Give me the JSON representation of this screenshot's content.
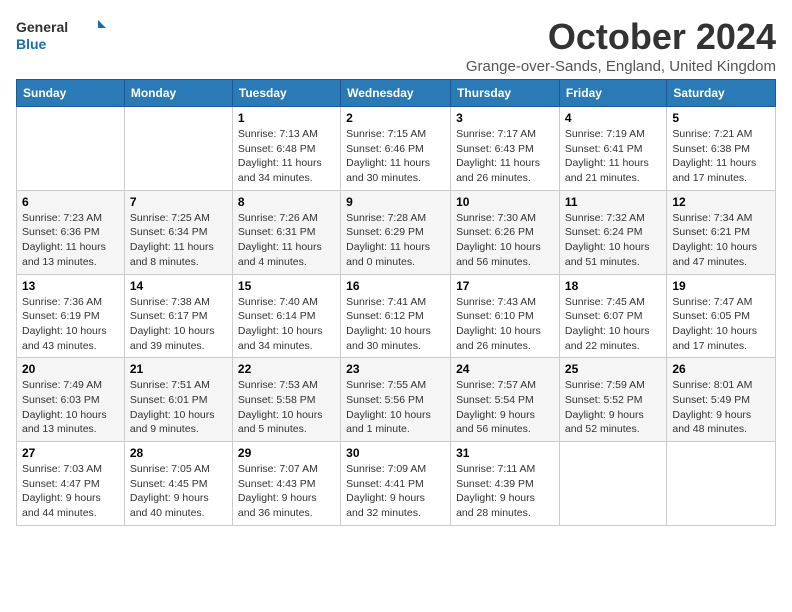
{
  "header": {
    "logo_line1": "General",
    "logo_line2": "Blue",
    "title": "October 2024",
    "location": "Grange-over-Sands, England, United Kingdom"
  },
  "columns": [
    "Sunday",
    "Monday",
    "Tuesday",
    "Wednesday",
    "Thursday",
    "Friday",
    "Saturday"
  ],
  "weeks": [
    [
      {
        "day": "",
        "info": ""
      },
      {
        "day": "",
        "info": ""
      },
      {
        "day": "1",
        "info": "Sunrise: 7:13 AM\nSunset: 6:48 PM\nDaylight: 11 hours and 34 minutes."
      },
      {
        "day": "2",
        "info": "Sunrise: 7:15 AM\nSunset: 6:46 PM\nDaylight: 11 hours and 30 minutes."
      },
      {
        "day": "3",
        "info": "Sunrise: 7:17 AM\nSunset: 6:43 PM\nDaylight: 11 hours and 26 minutes."
      },
      {
        "day": "4",
        "info": "Sunrise: 7:19 AM\nSunset: 6:41 PM\nDaylight: 11 hours and 21 minutes."
      },
      {
        "day": "5",
        "info": "Sunrise: 7:21 AM\nSunset: 6:38 PM\nDaylight: 11 hours and 17 minutes."
      }
    ],
    [
      {
        "day": "6",
        "info": "Sunrise: 7:23 AM\nSunset: 6:36 PM\nDaylight: 11 hours and 13 minutes."
      },
      {
        "day": "7",
        "info": "Sunrise: 7:25 AM\nSunset: 6:34 PM\nDaylight: 11 hours and 8 minutes."
      },
      {
        "day": "8",
        "info": "Sunrise: 7:26 AM\nSunset: 6:31 PM\nDaylight: 11 hours and 4 minutes."
      },
      {
        "day": "9",
        "info": "Sunrise: 7:28 AM\nSunset: 6:29 PM\nDaylight: 11 hours and 0 minutes."
      },
      {
        "day": "10",
        "info": "Sunrise: 7:30 AM\nSunset: 6:26 PM\nDaylight: 10 hours and 56 minutes."
      },
      {
        "day": "11",
        "info": "Sunrise: 7:32 AM\nSunset: 6:24 PM\nDaylight: 10 hours and 51 minutes."
      },
      {
        "day": "12",
        "info": "Sunrise: 7:34 AM\nSunset: 6:21 PM\nDaylight: 10 hours and 47 minutes."
      }
    ],
    [
      {
        "day": "13",
        "info": "Sunrise: 7:36 AM\nSunset: 6:19 PM\nDaylight: 10 hours and 43 minutes."
      },
      {
        "day": "14",
        "info": "Sunrise: 7:38 AM\nSunset: 6:17 PM\nDaylight: 10 hours and 39 minutes."
      },
      {
        "day": "15",
        "info": "Sunrise: 7:40 AM\nSunset: 6:14 PM\nDaylight: 10 hours and 34 minutes."
      },
      {
        "day": "16",
        "info": "Sunrise: 7:41 AM\nSunset: 6:12 PM\nDaylight: 10 hours and 30 minutes."
      },
      {
        "day": "17",
        "info": "Sunrise: 7:43 AM\nSunset: 6:10 PM\nDaylight: 10 hours and 26 minutes."
      },
      {
        "day": "18",
        "info": "Sunrise: 7:45 AM\nSunset: 6:07 PM\nDaylight: 10 hours and 22 minutes."
      },
      {
        "day": "19",
        "info": "Sunrise: 7:47 AM\nSunset: 6:05 PM\nDaylight: 10 hours and 17 minutes."
      }
    ],
    [
      {
        "day": "20",
        "info": "Sunrise: 7:49 AM\nSunset: 6:03 PM\nDaylight: 10 hours and 13 minutes."
      },
      {
        "day": "21",
        "info": "Sunrise: 7:51 AM\nSunset: 6:01 PM\nDaylight: 10 hours and 9 minutes."
      },
      {
        "day": "22",
        "info": "Sunrise: 7:53 AM\nSunset: 5:58 PM\nDaylight: 10 hours and 5 minutes."
      },
      {
        "day": "23",
        "info": "Sunrise: 7:55 AM\nSunset: 5:56 PM\nDaylight: 10 hours and 1 minute."
      },
      {
        "day": "24",
        "info": "Sunrise: 7:57 AM\nSunset: 5:54 PM\nDaylight: 9 hours and 56 minutes."
      },
      {
        "day": "25",
        "info": "Sunrise: 7:59 AM\nSunset: 5:52 PM\nDaylight: 9 hours and 52 minutes."
      },
      {
        "day": "26",
        "info": "Sunrise: 8:01 AM\nSunset: 5:49 PM\nDaylight: 9 hours and 48 minutes."
      }
    ],
    [
      {
        "day": "27",
        "info": "Sunrise: 7:03 AM\nSunset: 4:47 PM\nDaylight: 9 hours and 44 minutes."
      },
      {
        "day": "28",
        "info": "Sunrise: 7:05 AM\nSunset: 4:45 PM\nDaylight: 9 hours and 40 minutes."
      },
      {
        "day": "29",
        "info": "Sunrise: 7:07 AM\nSunset: 4:43 PM\nDaylight: 9 hours and 36 minutes."
      },
      {
        "day": "30",
        "info": "Sunrise: 7:09 AM\nSunset: 4:41 PM\nDaylight: 9 hours and 32 minutes."
      },
      {
        "day": "31",
        "info": "Sunrise: 7:11 AM\nSunset: 4:39 PM\nDaylight: 9 hours and 28 minutes."
      },
      {
        "day": "",
        "info": ""
      },
      {
        "day": "",
        "info": ""
      }
    ]
  ]
}
